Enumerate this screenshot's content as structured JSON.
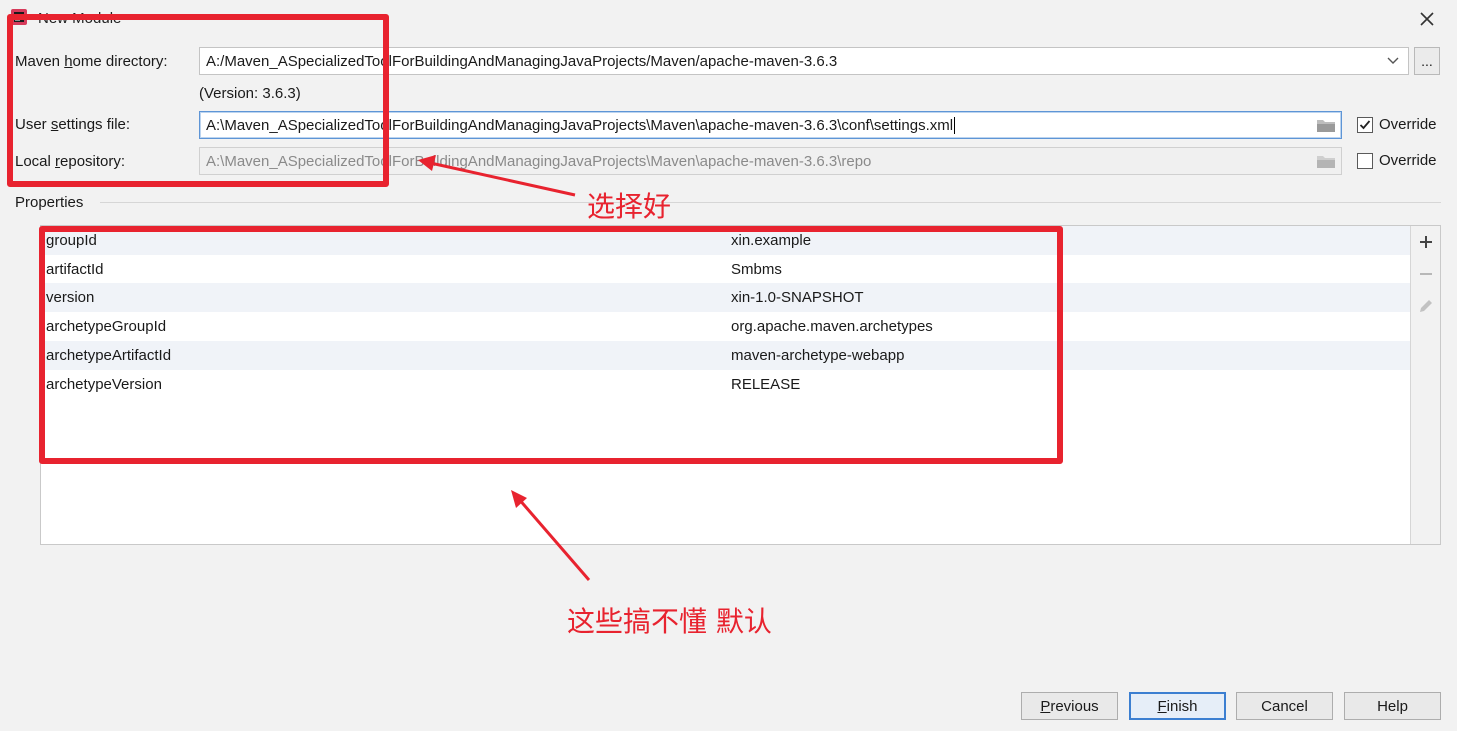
{
  "window": {
    "title": "New Module"
  },
  "maven_home": {
    "label_prefix": "Maven ",
    "label_mnemonic": "h",
    "label_suffix": "ome directory:",
    "value": "A:/Maven_ASpecializedToolForBuildingAndManagingJavaProjects/Maven/apache-maven-3.6.3",
    "version": "(Version: 3.6.3)",
    "browse_label": "..."
  },
  "user_settings": {
    "label_prefix": "User ",
    "label_mnemonic": "s",
    "label_suffix": "ettings file:",
    "value": "A:\\Maven_ASpecializedToolForBuildingAndManagingJavaProjects\\Maven\\apache-maven-3.6.3\\conf\\settings.xml",
    "override_label": "Override",
    "override_checked": true
  },
  "local_repo": {
    "label_prefix": "Local ",
    "label_mnemonic": "r",
    "label_suffix": "epository:",
    "value": "A:\\Maven_ASpecializedToolForBuildingAndManagingJavaProjects\\Maven\\apache-maven-3.6.3\\repo",
    "override_label": "Override",
    "override_checked": false
  },
  "properties": {
    "title": "Properties",
    "rows": [
      {
        "key": "groupId",
        "value": "xin.example"
      },
      {
        "key": "artifactId",
        "value": "Smbms"
      },
      {
        "key": "version",
        "value": "xin-1.0-SNAPSHOT"
      },
      {
        "key": "archetypeGroupId",
        "value": "org.apache.maven.archetypes"
      },
      {
        "key": "archetypeArtifactId",
        "value": "maven-archetype-webapp"
      },
      {
        "key": "archetypeVersion",
        "value": "RELEASE"
      }
    ]
  },
  "annotations": {
    "note_select": "选择好",
    "note_default": "这些搞不懂 默认"
  },
  "buttons": {
    "previous_mnemonic": "P",
    "previous_rest": "revious",
    "finish_mnemonic": "F",
    "finish_rest": "inish",
    "cancel": "Cancel",
    "help": "Help"
  },
  "colors": {
    "annotation_red": "#e8232f",
    "focus_blue": "#5e95d6",
    "row_alt": "#f0f3f8"
  }
}
